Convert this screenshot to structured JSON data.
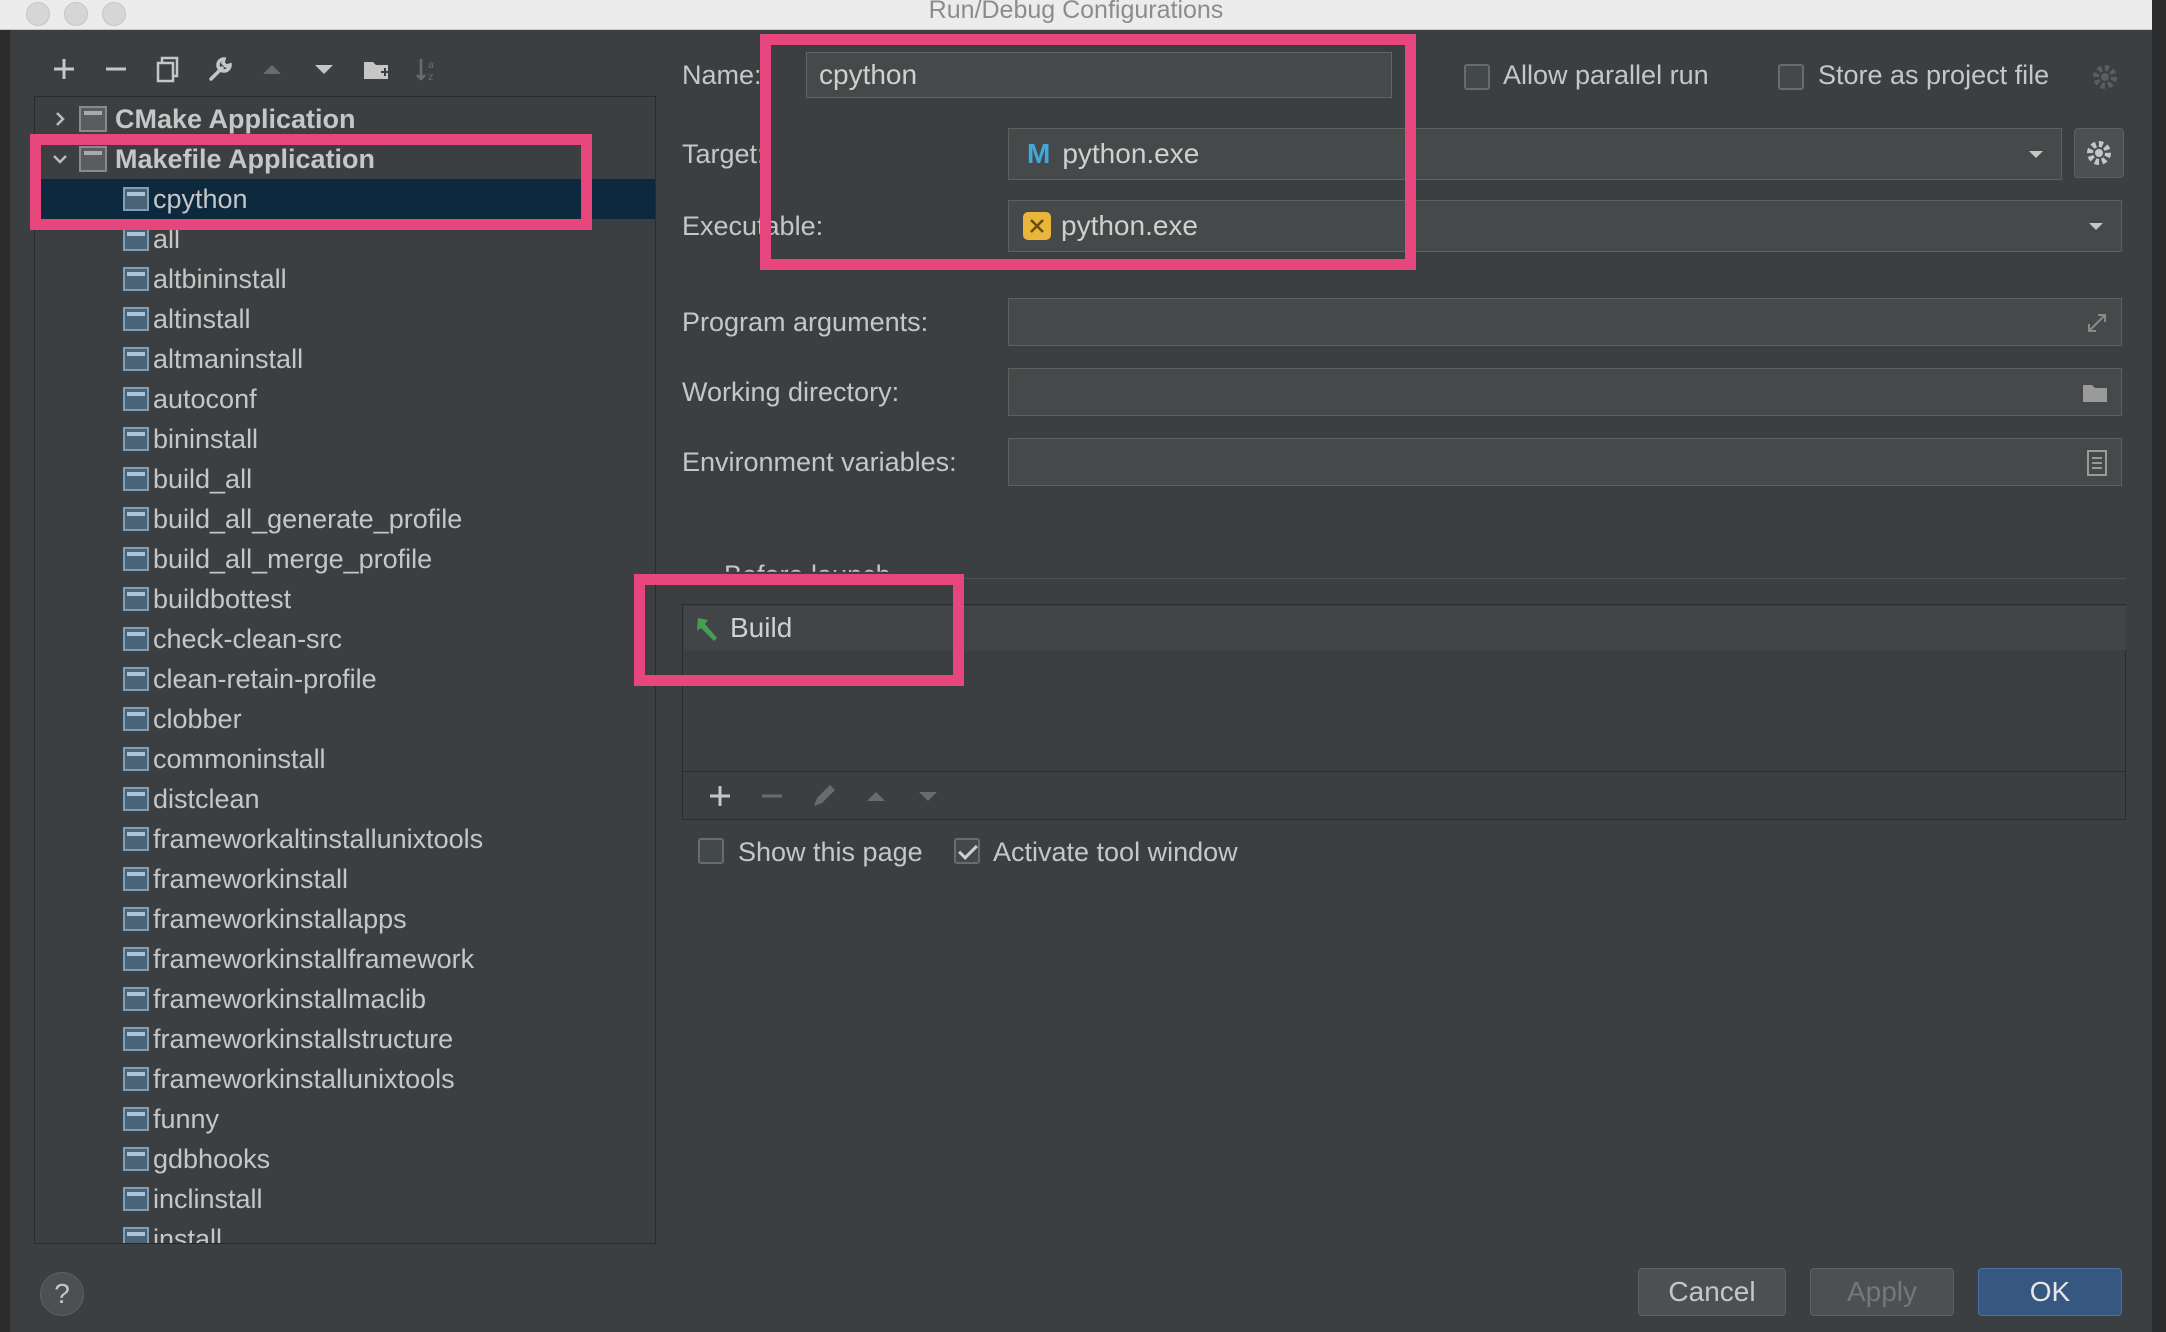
{
  "window": {
    "title": "Run/Debug Configurations"
  },
  "toolbar": {
    "icons": [
      "add-icon",
      "remove-icon",
      "copy-icon",
      "wrench-icon",
      "move-up-icon",
      "move-down-icon",
      "folder-icon",
      "sort-icon"
    ]
  },
  "tree": {
    "groups": [
      {
        "label": "CMake Application",
        "expanded": false
      },
      {
        "label": "Makefile Application",
        "expanded": true
      }
    ],
    "items": [
      "cpython",
      "all",
      "altbininstall",
      "altinstall",
      "altmaninstall",
      "autoconf",
      "bininstall",
      "build_all",
      "build_all_generate_profile",
      "build_all_merge_profile",
      "buildbottest",
      "check-clean-src",
      "clean-retain-profile",
      "clobber",
      "commoninstall",
      "distclean",
      "frameworkaltinstallunixtools",
      "frameworkinstall",
      "frameworkinstallapps",
      "frameworkinstallframework",
      "frameworkinstallmaclib",
      "frameworkinstallstructure",
      "frameworkinstallunixtools",
      "funny",
      "gdbhooks",
      "inclinstall",
      "install"
    ],
    "selected": "cpython"
  },
  "form": {
    "name_label": "Name:",
    "name_value": "cpython",
    "allow_parallel_label": "Allow parallel run",
    "store_project_label": "Store as project file",
    "target_label": "Target:",
    "target_value": "python.exe",
    "executable_label": "Executable:",
    "executable_value": "python.exe",
    "program_args_label": "Program arguments:",
    "program_args_value": "",
    "working_dir_label": "Working directory:",
    "working_dir_value": "",
    "env_vars_label": "Environment variables:",
    "env_vars_value": ""
  },
  "before_launch": {
    "label": "Before launch",
    "tasks": [
      "Build"
    ],
    "show_page_label": "Show this page",
    "show_page_checked": false,
    "activate_tool_label": "Activate tool window",
    "activate_tool_checked": true
  },
  "buttons": {
    "cancel": "Cancel",
    "apply": "Apply",
    "ok": "OK",
    "help": "?"
  },
  "colors": {
    "highlight": "#e6467c",
    "selection": "#0d293e",
    "ok_button": "#365880"
  }
}
